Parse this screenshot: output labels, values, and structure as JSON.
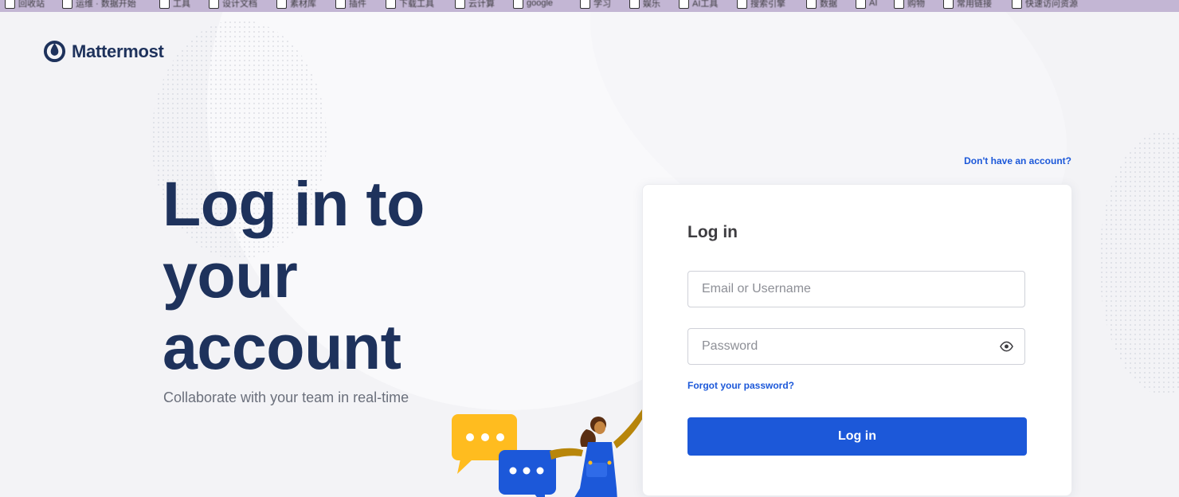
{
  "bookmarks_bar": {
    "items": [
      {
        "label": "回收站"
      },
      {
        "label": "运维 · 数据开始"
      },
      {
        "label": "工具"
      },
      {
        "label": "设计文档"
      },
      {
        "label": "素材库"
      },
      {
        "label": "插件"
      },
      {
        "label": "下载工具"
      },
      {
        "label": "云计算"
      },
      {
        "label": "google"
      },
      {
        "label": "学习"
      },
      {
        "label": "娱乐"
      },
      {
        "label": "AI工具"
      },
      {
        "label": "搜索引擎"
      },
      {
        "label": "数据"
      },
      {
        "label": "AI"
      },
      {
        "label": "购物"
      },
      {
        "label": "常用链接"
      },
      {
        "label": "快速访问资源"
      }
    ]
  },
  "brand": {
    "name": "Mattermost",
    "logo_icon": "mattermost-logo-icon",
    "color": "#1e325c"
  },
  "hero": {
    "title": "Log in to your account",
    "subtitle": "Collaborate with your team in real-time"
  },
  "header": {
    "signup_link": "Don't have an account?"
  },
  "login_form": {
    "title": "Log in",
    "username_placeholder": "Email or Username",
    "password_placeholder": "Password",
    "password_toggle_icon": "eye-icon",
    "forgot_link": "Forgot your password?",
    "submit_label": "Log in"
  },
  "colors": {
    "accent": "#1c58d9",
    "heading": "#1e325c",
    "page_background": "#f3f3f6",
    "bookmarks_bar": "#c3b6d4",
    "bubble_yellow": "#ffbc1f",
    "bubble_blue": "#1c58d9"
  }
}
